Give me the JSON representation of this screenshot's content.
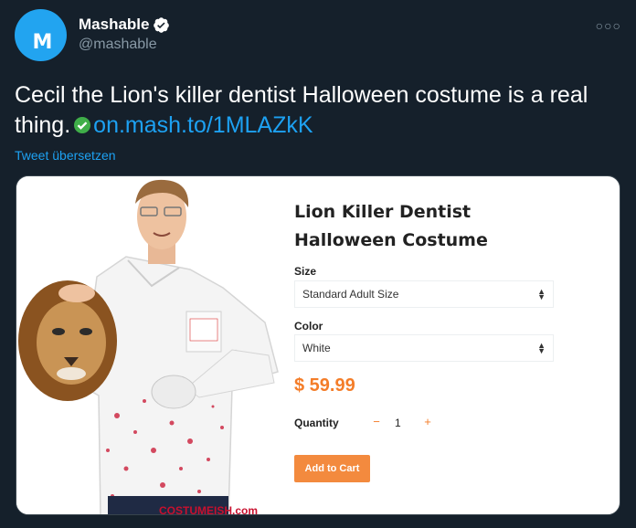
{
  "account": {
    "display_name": "Mashable",
    "handle": "@mashable",
    "avatar_letter": "M",
    "avatar_color": "#22a4f0"
  },
  "tweet": {
    "text": "Cecil the Lion's killer dentist Halloween costume is a real thing.",
    "link": "on.mash.to/1MLAZkK",
    "translate_label": "Tweet übersetzen",
    "more_icon": "more-dots-icon"
  },
  "card": {
    "product_title": "Lion Killer Dentist Halloween Costume",
    "size_label": "Size",
    "size_value": "Standard Adult Size",
    "color_label": "Color",
    "color_value": "White",
    "price": "$ 59.99",
    "quantity_label": "Quantity",
    "quantity_minus": "−",
    "quantity_value": "1",
    "quantity_plus": "+",
    "add_to_cart": "Add to Cart",
    "watermark": "COSTUMEISH.com",
    "accent_color": "#f47d29"
  },
  "theme": {
    "background": "#15202b",
    "link_color": "#1da1f2",
    "muted_text": "#8899a6"
  }
}
